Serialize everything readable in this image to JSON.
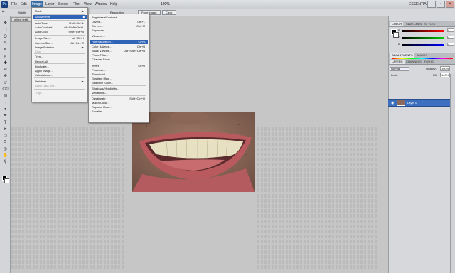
{
  "titlebar": {
    "logo": "Ps",
    "menus": [
      "File",
      "Edit",
      "Image",
      "Layer",
      "Select",
      "Filter",
      "View",
      "Window",
      "Help"
    ],
    "active_menu": "Image",
    "zoom": "100%",
    "workspace": "ESSENTIALS ▾",
    "win_min": "–",
    "win_max": "▫",
    "win_close": "×"
  },
  "options": {
    "width_label": "Width:",
    "resolution_label": "Resolution:",
    "front_image": "Front Image",
    "clear": "Clear"
  },
  "document": {
    "tab_label": "yellow-teeth"
  },
  "image_menu": {
    "items": [
      {
        "label": "Mode",
        "shortcut": "",
        "submenu": true,
        "disabled": false
      },
      {
        "label": "Adjustments",
        "shortcut": "",
        "submenu": true,
        "disabled": false,
        "highlighted": true
      },
      {
        "label": "Auto Tone",
        "shortcut": "Shift+Ctrl+L",
        "disabled": false
      },
      {
        "label": "Auto Contrast",
        "shortcut": "Alt+Shift+Ctrl+L",
        "disabled": false
      },
      {
        "label": "Auto Color",
        "shortcut": "Shift+Ctrl+B",
        "disabled": false
      },
      {
        "label": "Image Size...",
        "shortcut": "Alt+Ctrl+I",
        "disabled": false
      },
      {
        "label": "Canvas Size...",
        "shortcut": "Alt+Ctrl+C",
        "disabled": false
      },
      {
        "label": "Image Rotation",
        "shortcut": "",
        "submenu": true,
        "disabled": false
      },
      {
        "label": "Crop",
        "shortcut": "",
        "disabled": true
      },
      {
        "label": "Trim...",
        "shortcut": "",
        "disabled": false
      },
      {
        "label": "Reveal All",
        "shortcut": "",
        "disabled": false
      },
      {
        "label": "Duplicate...",
        "shortcut": "",
        "disabled": false
      },
      {
        "label": "Apply Image...",
        "shortcut": "",
        "disabled": false
      },
      {
        "label": "Calculations...",
        "shortcut": "",
        "disabled": false
      },
      {
        "label": "Variables",
        "shortcut": "",
        "submenu": true,
        "disabled": false
      },
      {
        "label": "Apply Data Set...",
        "shortcut": "",
        "disabled": true
      },
      {
        "label": "Trap...",
        "shortcut": "",
        "disabled": true
      }
    ]
  },
  "adjustments_menu": {
    "items": [
      {
        "label": "Brightness/Contrast...",
        "shortcut": ""
      },
      {
        "label": "Levels...",
        "shortcut": "Ctrl+L"
      },
      {
        "label": "Curves...",
        "shortcut": "Ctrl+M"
      },
      {
        "label": "Exposure...",
        "shortcut": ""
      },
      {
        "label": "Vibrance...",
        "shortcut": ""
      },
      {
        "label": "Hue/Saturation...",
        "shortcut": "Ctrl+U",
        "highlighted": true
      },
      {
        "label": "Color Balance...",
        "shortcut": "Ctrl+B"
      },
      {
        "label": "Black & White...",
        "shortcut": "Alt+Shift+Ctrl+B"
      },
      {
        "label": "Photo Filter...",
        "shortcut": ""
      },
      {
        "label": "Channel Mixer...",
        "shortcut": ""
      },
      {
        "label": "Invert",
        "shortcut": "Ctrl+I"
      },
      {
        "label": "Posterize...",
        "shortcut": ""
      },
      {
        "label": "Threshold...",
        "shortcut": ""
      },
      {
        "label": "Gradient Map...",
        "shortcut": ""
      },
      {
        "label": "Selective Color...",
        "shortcut": ""
      },
      {
        "label": "Shadows/Highlights...",
        "shortcut": ""
      },
      {
        "label": "Variations...",
        "shortcut": ""
      },
      {
        "label": "Desaturate",
        "shortcut": "Shift+Ctrl+U"
      },
      {
        "label": "Match Color...",
        "shortcut": ""
      },
      {
        "label": "Replace Color...",
        "shortcut": ""
      },
      {
        "label": "Equalize",
        "shortcut": ""
      }
    ]
  },
  "panels": {
    "color_tabs": [
      "COLOR",
      "SWATCHES",
      "STYLES"
    ],
    "sliders": [
      {
        "label": "R",
        "value": "0",
        "color": "#ff0000"
      },
      {
        "label": "G",
        "value": "0",
        "color": "#00c000"
      },
      {
        "label": "B",
        "value": "0",
        "color": "#0000ff"
      }
    ],
    "adjust_tabs": [
      "ADJUSTMENTS",
      "MASKS"
    ],
    "layers_tabs": [
      "LAYERS",
      "CHANNELS",
      "PATHS"
    ],
    "blend_mode": "Normal",
    "opacity_label": "Opacity:",
    "opacity": "100%",
    "lock_label": "Lock:",
    "fill_label": "Fill:",
    "fill": "100%",
    "layer_name": "Layer 0"
  },
  "icons": {
    "tools": [
      "move-tool-icon",
      "marquee-tool-icon",
      "lasso-tool-icon",
      "quick-select-icon",
      "crop-tool-icon",
      "eyedropper-icon",
      "healing-brush-icon",
      "brush-tool-icon",
      "clone-stamp-icon",
      "history-brush-icon",
      "eraser-icon",
      "gradient-icon",
      "blur-icon",
      "dodge-icon",
      "pen-tool-icon",
      "type-tool-icon",
      "path-select-icon",
      "shape-tool-icon",
      "3d-rotate-icon",
      "3d-orbit-icon",
      "hand-tool-icon",
      "zoom-tool-icon"
    ],
    "glyphs": [
      "✥",
      "⬚",
      "ʘ",
      "✎",
      "⌗",
      "✐",
      "✚",
      "✏",
      "⎈",
      "↺",
      "⌫",
      "▤",
      "◔",
      "●",
      "✒",
      "T",
      "➤",
      "▭",
      "⟳",
      "◎",
      "✋",
      "⚲"
    ]
  }
}
